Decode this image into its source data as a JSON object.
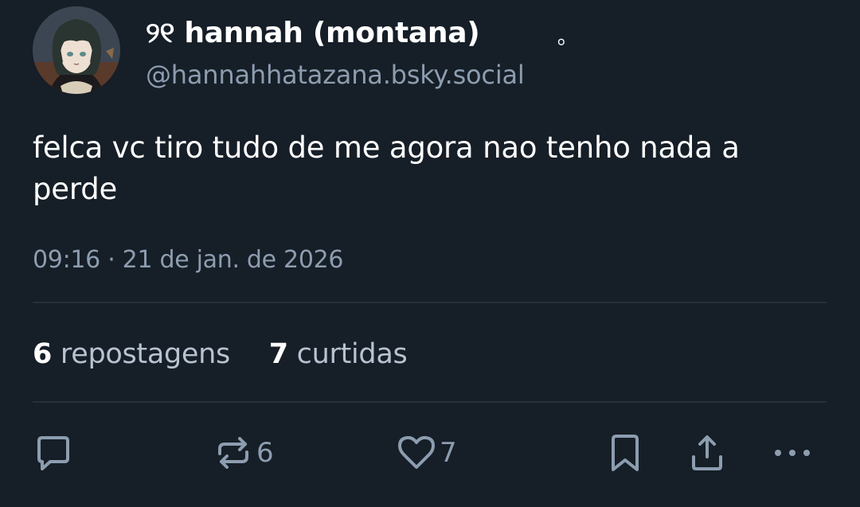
{
  "author": {
    "display_name": "୨୧ hannah (montana)",
    "name_suffix": "｡",
    "handle": "@hannahhatazana.bsky.social",
    "avatar_icon": "anime-girl-avatar"
  },
  "post": {
    "text": "felca vc tiro tudo de me agora nao tenho nada a perde",
    "timestamp": "09:16 · 21 de jan. de 2026"
  },
  "stats": {
    "reposts_count": "6",
    "reposts_label": "repostagens",
    "likes_count": "7",
    "likes_label": "curtidas"
  },
  "actions": {
    "reply_icon": "comment-bubble-icon",
    "repost_icon": "repost-icon",
    "repost_count": "6",
    "like_icon": "heart-icon",
    "like_count": "7",
    "bookmark_icon": "bookmark-icon",
    "share_icon": "share-icon",
    "more_icon": "more-horizontal-icon"
  },
  "colors": {
    "background": "#161e27",
    "primary_text": "#ffffff",
    "secondary_text": "#8d9db0",
    "divider": "#262f3a"
  }
}
